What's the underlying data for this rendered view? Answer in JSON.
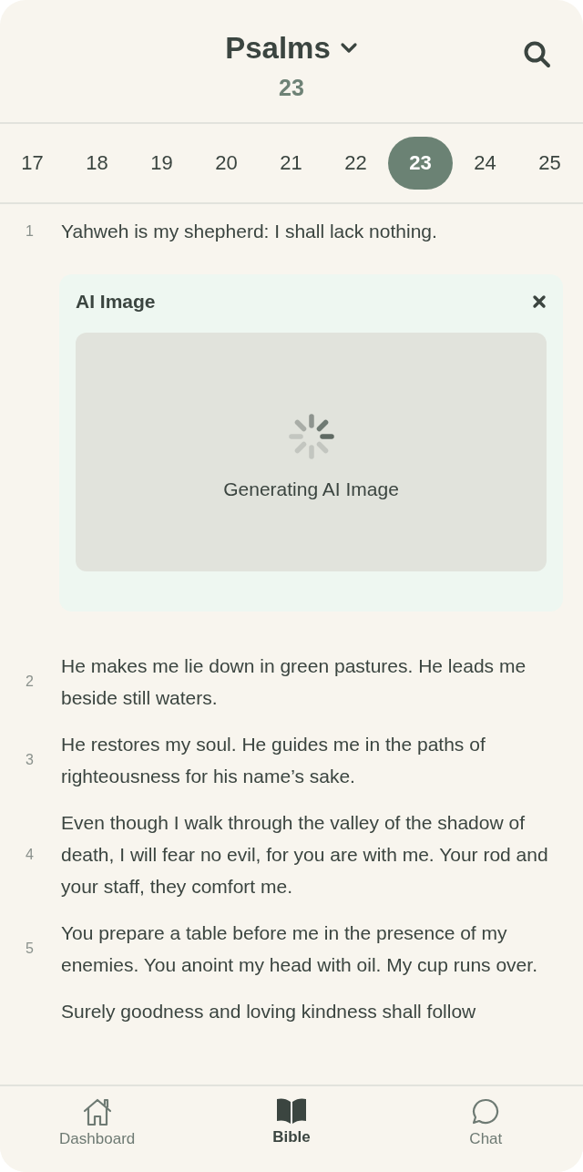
{
  "header": {
    "book": "Psalms",
    "chapter": "23"
  },
  "chapters": [
    {
      "label": "17",
      "selected": false
    },
    {
      "label": "18",
      "selected": false
    },
    {
      "label": "19",
      "selected": false
    },
    {
      "label": "20",
      "selected": false
    },
    {
      "label": "21",
      "selected": false
    },
    {
      "label": "22",
      "selected": false
    },
    {
      "label": "23",
      "selected": true
    },
    {
      "label": "24",
      "selected": false
    },
    {
      "label": "25",
      "selected": false
    }
  ],
  "verses": [
    {
      "number": "1",
      "text": "Yahweh is my shepherd: I shall lack nothing."
    },
    {
      "kind": "ai_image",
      "title": "AI Image",
      "status": "Generating AI Image"
    },
    {
      "number": "2",
      "text": "He makes me lie down in green pastures. He leads me beside still waters."
    },
    {
      "number": "3",
      "text": "He restores my soul. He guides me in the paths of righteousness for his name’s sake."
    },
    {
      "number": "4",
      "text": "Even though I walk through the valley of the shadow of death, I will fear no evil, for you are with me. Your rod and your staff, they comfort me."
    },
    {
      "number": "5",
      "text": "You prepare a table before me in the presence of my enemies. You anoint my head with oil. My cup runs over."
    },
    {
      "text": "Surely goodness and loving kindness shall follow"
    }
  ],
  "tabs": [
    {
      "kind": "home",
      "label": "Dashboard",
      "selected": false
    },
    {
      "kind": "book",
      "label": "Bible",
      "selected": true
    },
    {
      "kind": "chat",
      "label": "Chat",
      "selected": false
    }
  ]
}
